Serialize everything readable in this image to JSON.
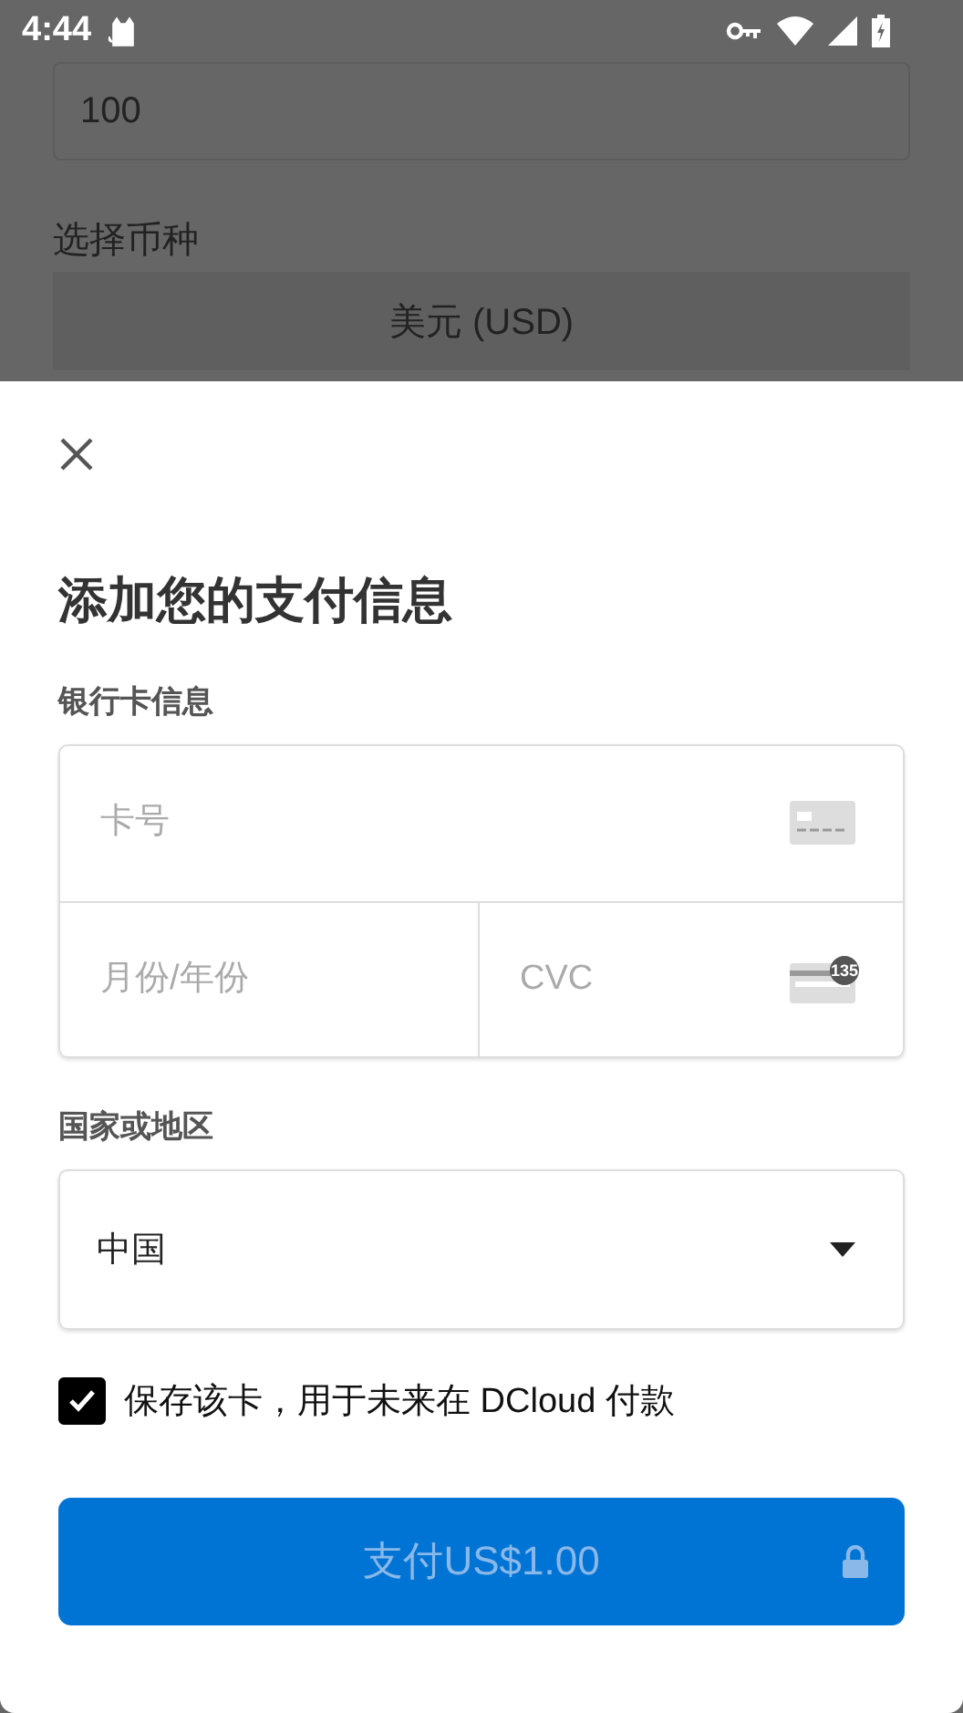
{
  "status_bar": {
    "time": "4:44"
  },
  "background": {
    "amount_value": "100",
    "currency_label": "选择币种",
    "currency_value": "美元 (USD)"
  },
  "sheet": {
    "title": "添加您的支付信息",
    "card_section_label": "银行卡信息",
    "card_number": {
      "placeholder": "卡号"
    },
    "expiry": {
      "placeholder": "月份/年份"
    },
    "cvc": {
      "placeholder": "CVC",
      "icon_badge": "135"
    },
    "country_label": "国家或地区",
    "country_value": "中国",
    "save_card": {
      "label": "保存该卡，用于未来在 DCloud 付款",
      "checked": true
    },
    "pay_button": {
      "label": "支付US$1.00",
      "disabled": true
    }
  }
}
